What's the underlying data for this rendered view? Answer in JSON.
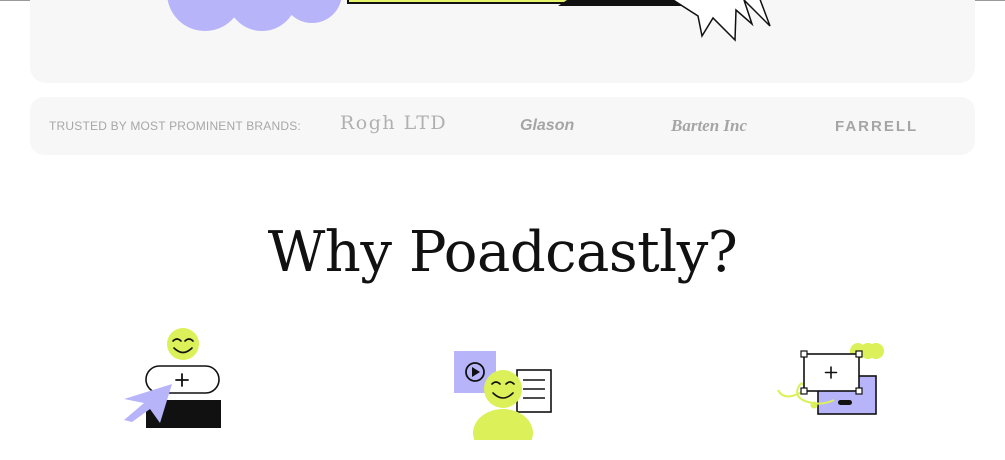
{
  "colors": {
    "lavender": "#b7b4f9",
    "lime": "#dcf05a",
    "ink": "#111111",
    "muted": "#a7a7a7",
    "card": "#f7f7f7"
  },
  "brands": {
    "label": "TRUSTED BY MOST PROMINENT BRANDS:",
    "items": [
      "Rogh LTD",
      "Glason",
      "Barten Inc",
      "FARRELL"
    ]
  },
  "section": {
    "title": "Why Poadcastly?"
  },
  "features": [
    {
      "icon": "add-cursor-smiley-icon"
    },
    {
      "icon": "video-chat-smiley-icon"
    },
    {
      "icon": "screen-select-add-icon"
    }
  ]
}
